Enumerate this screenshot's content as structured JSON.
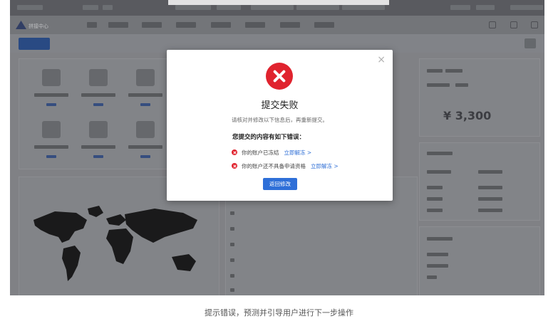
{
  "brand": {
    "name": "拼接中心"
  },
  "dashboard": {
    "balance": "¥ 3,300"
  },
  "modal": {
    "title": "提交失败",
    "description": "请核对并修改以下信息后，再重新提交。",
    "errors_heading": "您提交的内容有如下错误：",
    "errors": [
      {
        "text": "你的账户已冻结",
        "link": "立即解冻 >"
      },
      {
        "text": "你的账户还不具备申请资格",
        "link": "立即解冻 >"
      }
    ],
    "button_label": "返回修改",
    "close_symbol": "×"
  },
  "caption": "提示错误，预测并引导用户进行下一步操作",
  "colors": {
    "error_red": "#e0232e",
    "primary_blue": "#2e6fd8",
    "link_blue": "#2f6fd6"
  },
  "icons": [
    "error-circle-icon",
    "close-icon",
    "error-bullet-icon"
  ]
}
